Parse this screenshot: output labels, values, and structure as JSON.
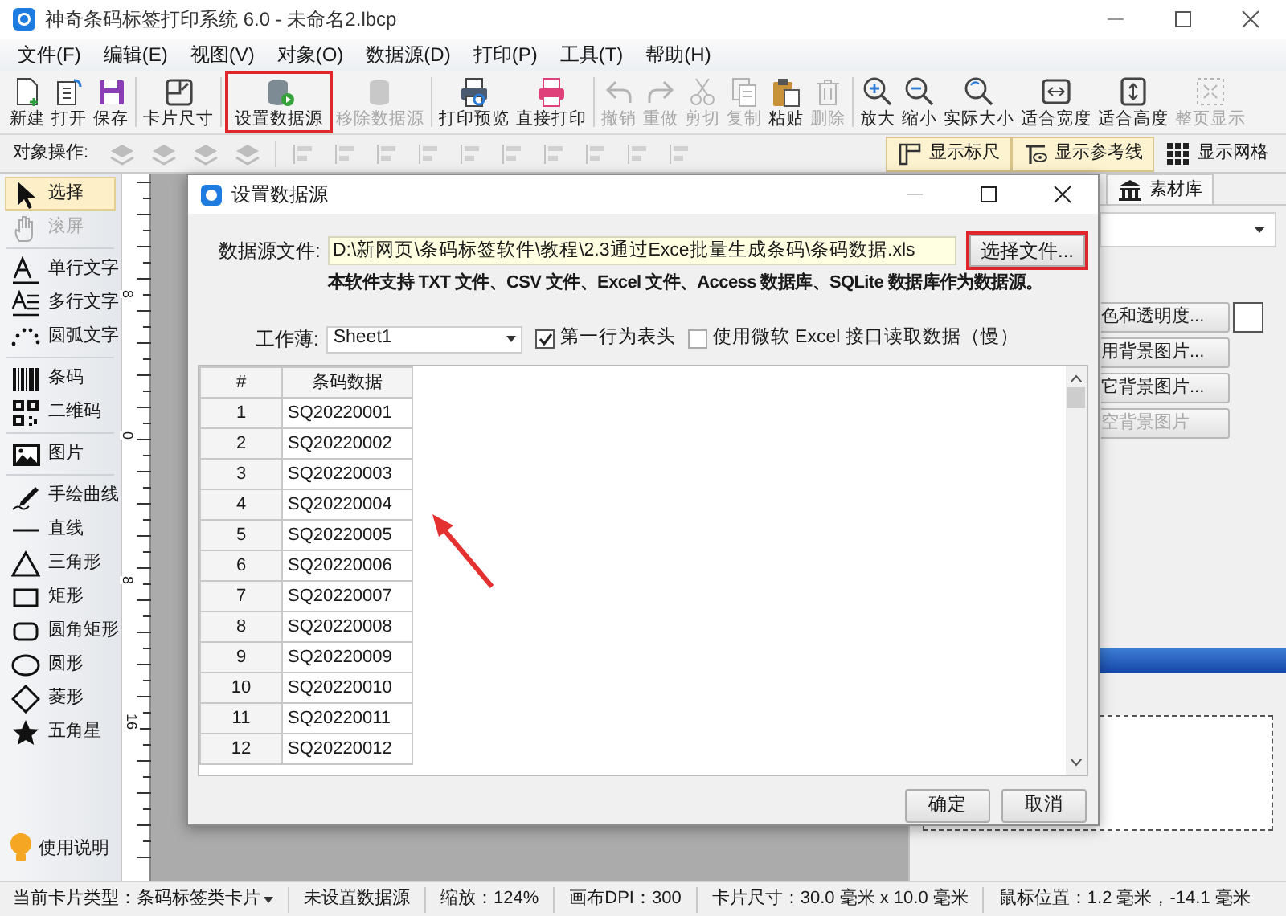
{
  "window": {
    "title": "神奇条码标签打印系统 6.0 - 未命名2.lbcp"
  },
  "menu": [
    "文件(F)",
    "编辑(E)",
    "视图(V)",
    "对象(O)",
    "数据源(D)",
    "打印(P)",
    "工具(T)",
    "帮助(H)"
  ],
  "toolbar": [
    [
      {
        "label": "新建",
        "disabled": false,
        "highlighted": false
      },
      {
        "label": "打开",
        "disabled": false,
        "highlighted": false
      },
      {
        "label": "保存",
        "disabled": false,
        "highlighted": false
      }
    ],
    [
      {
        "label": "卡片尺寸",
        "disabled": false,
        "highlighted": false
      }
    ],
    [
      {
        "label": "设置数据源",
        "disabled": false,
        "highlighted": true
      },
      {
        "label": "移除数据源",
        "disabled": true,
        "highlighted": false
      }
    ],
    [
      {
        "label": "打印预览",
        "disabled": false,
        "highlighted": false
      },
      {
        "label": "直接打印",
        "disabled": false,
        "highlighted": false
      }
    ],
    [
      {
        "label": "撤销",
        "disabled": true,
        "highlighted": false
      },
      {
        "label": "重做",
        "disabled": true,
        "highlighted": false
      },
      {
        "label": "剪切",
        "disabled": true,
        "highlighted": false
      },
      {
        "label": "复制",
        "disabled": true,
        "highlighted": false
      },
      {
        "label": "粘贴",
        "disabled": false,
        "highlighted": false
      },
      {
        "label": "删除",
        "disabled": true,
        "highlighted": false
      }
    ],
    [
      {
        "label": "放大",
        "disabled": false,
        "highlighted": false
      },
      {
        "label": "缩小",
        "disabled": false,
        "highlighted": false
      },
      {
        "label": "实际大小",
        "disabled": false,
        "highlighted": false
      },
      {
        "label": "适合宽度",
        "disabled": false,
        "highlighted": false
      },
      {
        "label": "适合高度",
        "disabled": false,
        "highlighted": false
      },
      {
        "label": "整页显示",
        "disabled": true,
        "highlighted": false
      }
    ]
  ],
  "object_bar": {
    "label": "对象操作:",
    "toggles": [
      {
        "label": "显示标尺",
        "on": true
      },
      {
        "label": "显示参考线",
        "on": true
      },
      {
        "label": "显示网格",
        "on": false
      }
    ]
  },
  "tools": [
    [
      {
        "label": "选择",
        "selected": true,
        "disabled": false
      },
      {
        "label": "滚屏",
        "selected": false,
        "disabled": true
      }
    ],
    [
      {
        "label": "单行文字",
        "selected": false,
        "disabled": false
      },
      {
        "label": "多行文字",
        "selected": false,
        "disabled": false
      },
      {
        "label": "圆弧文字",
        "selected": false,
        "disabled": false
      }
    ],
    [
      {
        "label": "条码",
        "selected": false,
        "disabled": false
      },
      {
        "label": "二维码",
        "selected": false,
        "disabled": false
      }
    ],
    [
      {
        "label": "图片",
        "selected": false,
        "disabled": false
      }
    ],
    [
      {
        "label": "手绘曲线",
        "selected": false,
        "disabled": false
      },
      {
        "label": "直线",
        "selected": false,
        "disabled": false
      },
      {
        "label": "三角形",
        "selected": false,
        "disabled": false
      },
      {
        "label": "矩形",
        "selected": false,
        "disabled": false
      },
      {
        "label": "圆角矩形",
        "selected": false,
        "disabled": false
      },
      {
        "label": "圆形",
        "selected": false,
        "disabled": false
      },
      {
        "label": "菱形",
        "selected": false,
        "disabled": false
      },
      {
        "label": "五角星",
        "selected": false,
        "disabled": false
      }
    ]
  ],
  "help": {
    "label": "使用说明"
  },
  "ruler": {
    "labels": [
      "8",
      "0",
      "8",
      "16"
    ]
  },
  "right_panel": {
    "tab": "素材库",
    "buttons": [
      {
        "label": "色和透明度...",
        "disabled": false
      },
      {
        "label": "用背景图片...",
        "disabled": false
      },
      {
        "label": "它背景图片...",
        "disabled": false
      },
      {
        "label": "空背景图片",
        "disabled": true
      }
    ]
  },
  "dialog": {
    "title": "设置数据源",
    "file_label": "数据源文件:",
    "file_value": "D:\\新网页\\条码标签软件\\教程\\2.3通过Exce批量生成条码\\条码数据.xls",
    "choose_button": {
      "label": "选择文件...",
      "highlighted": true
    },
    "note": "本软件支持 TXT 文件、CSV 文件、Excel 文件、Access 数据库、SQLite 数据库作为数据源。",
    "workbook_label": "工作薄:",
    "workbook_value": "Sheet1",
    "checkboxes": [
      {
        "label": "第一行为表头",
        "checked": true
      },
      {
        "label": "使用微软 Excel 接口读取数据（慢）",
        "checked": false
      }
    ],
    "table": {
      "columns": [
        "#",
        "条码数据"
      ],
      "rows": [
        [
          "1",
          "SQ20220001"
        ],
        [
          "2",
          "SQ20220002"
        ],
        [
          "3",
          "SQ20220003"
        ],
        [
          "4",
          "SQ20220004"
        ],
        [
          "5",
          "SQ20220005"
        ],
        [
          "6",
          "SQ20220006"
        ],
        [
          "7",
          "SQ20220007"
        ],
        [
          "8",
          "SQ20220008"
        ],
        [
          "9",
          "SQ20220009"
        ],
        [
          "10",
          "SQ20220010"
        ],
        [
          "11",
          "SQ20220011"
        ],
        [
          "12",
          "SQ20220012"
        ]
      ]
    },
    "buttons": [
      "确定",
      "取消"
    ]
  },
  "status_bar": {
    "card_type": {
      "label": "当前卡片类型：",
      "value": "条码标签类卡片"
    },
    "items": [
      "未设置数据源",
      "缩放：124%",
      "画布DPI：300",
      "卡片尺寸：30.0 毫米 x 10.0 毫米",
      "鼠标位置：1.2 毫米，-14.1 毫米"
    ]
  }
}
